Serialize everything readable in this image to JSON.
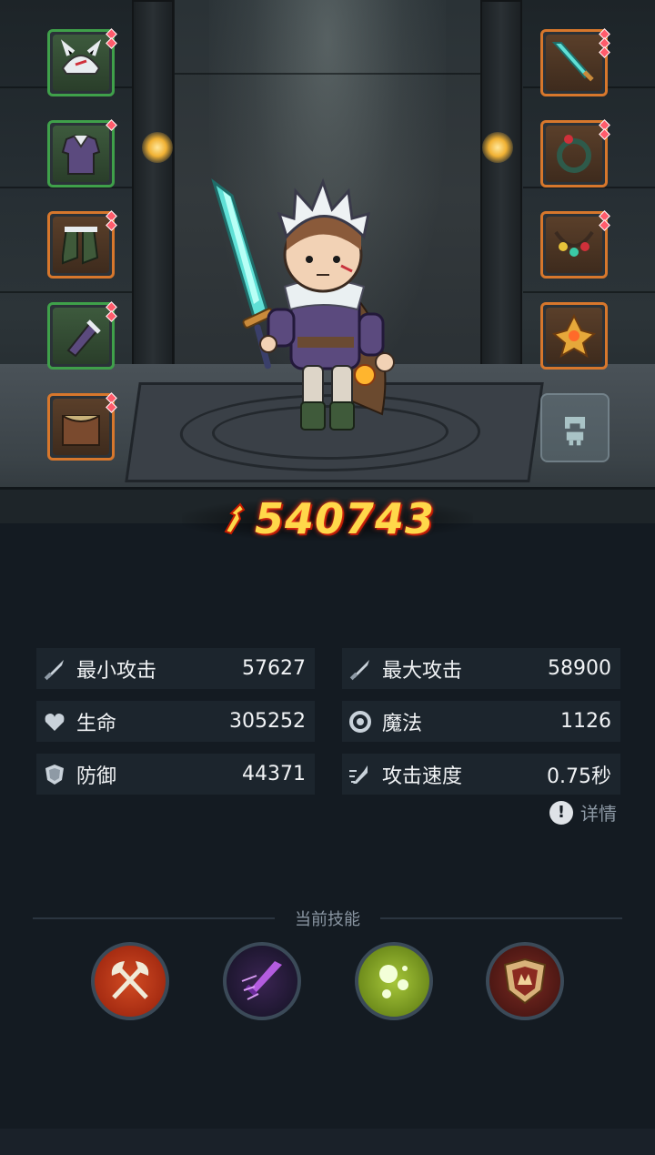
{
  "hero": {
    "power": "540743"
  },
  "equipment": {
    "left": [
      {
        "name": "helmet",
        "rarity": "green",
        "gems": 2
      },
      {
        "name": "armor",
        "rarity": "green",
        "gems": 1
      },
      {
        "name": "boots",
        "rarity": "orange",
        "gems": 2
      },
      {
        "name": "gloves",
        "rarity": "green",
        "gems": 2
      },
      {
        "name": "belt",
        "rarity": "orange",
        "gems": 2
      }
    ],
    "right": [
      {
        "name": "sword",
        "rarity": "orange",
        "gems": 3
      },
      {
        "name": "ring",
        "rarity": "orange",
        "gems": 2
      },
      {
        "name": "necklace",
        "rarity": "orange",
        "gems": 2
      },
      {
        "name": "amulet",
        "rarity": "orange",
        "gems": 0
      }
    ]
  },
  "stats": [
    {
      "label": "最小攻击",
      "value": "57627",
      "icon": "sword-icon"
    },
    {
      "label": "最大攻击",
      "value": "58900",
      "icon": "sword-icon"
    },
    {
      "label": "生命",
      "value": "305252",
      "icon": "heart-icon"
    },
    {
      "label": "魔法",
      "value": "1126",
      "icon": "magic-icon"
    },
    {
      "label": "防御",
      "value": "44371",
      "icon": "shield-icon"
    },
    {
      "label": "攻击速度",
      "value": "0.75秒",
      "icon": "speed-icon"
    }
  ],
  "details_label": "详情",
  "skills": {
    "title": "当前技能",
    "items": [
      {
        "name": "axes-skill"
      },
      {
        "name": "dagger-skill"
      },
      {
        "name": "poison-skill"
      },
      {
        "name": "shield-skill"
      }
    ]
  },
  "colors": {
    "background": "#141b22",
    "stat_row": "#1c252d",
    "power_text": "#ffd84a",
    "rarity_green": "#3fa04a",
    "rarity_orange": "#d7772c"
  }
}
